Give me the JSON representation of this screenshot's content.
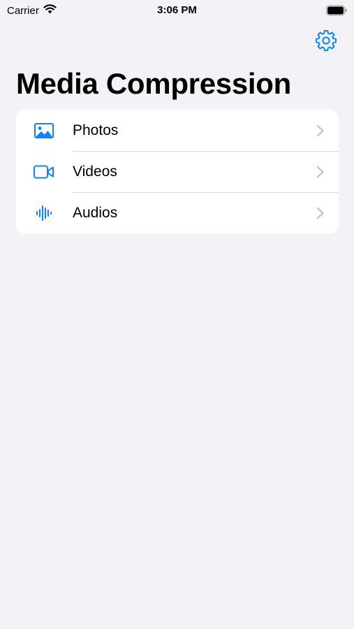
{
  "status_bar": {
    "carrier": "Carrier",
    "time": "3:06 PM",
    "wifi_icon": "wifi-icon",
    "battery_icon": "battery-icon"
  },
  "nav": {
    "settings_icon": "gear-icon"
  },
  "page": {
    "title": "Media Compression"
  },
  "list": {
    "items": [
      {
        "label": "Photos",
        "icon": "photo-icon"
      },
      {
        "label": "Videos",
        "icon": "video-camera-icon"
      },
      {
        "label": "Audios",
        "icon": "waveform-icon"
      }
    ]
  },
  "colors": {
    "accent": "#0a84ff",
    "background": "#f2f2f7",
    "card": "#ffffff",
    "chevron": "#c4c4c7"
  }
}
